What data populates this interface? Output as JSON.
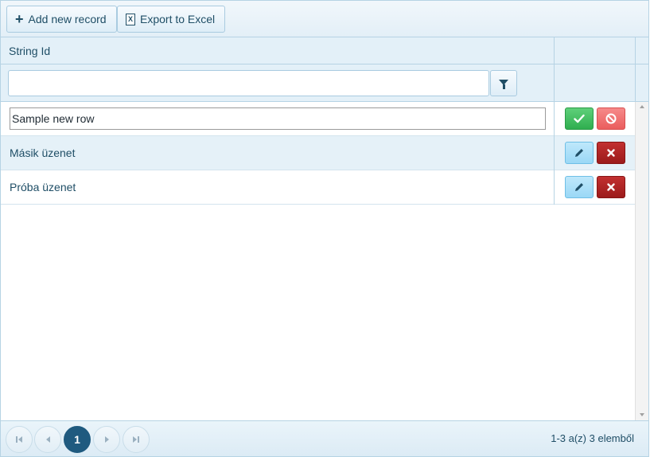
{
  "toolbar": {
    "add_label": "Add new record",
    "export_label": "Export to Excel",
    "excel_icon_letter": "X"
  },
  "header": {
    "column_title": "String Id"
  },
  "filter": {
    "value": "",
    "placeholder": ""
  },
  "rows": [
    {
      "mode": "edit",
      "value": "Sample new row"
    },
    {
      "mode": "view",
      "text": "Másik üzenet"
    },
    {
      "mode": "view",
      "text": "Próba üzenet"
    }
  ],
  "pager": {
    "current_page": "1",
    "info": "1-3 a(z) 3 elemből"
  },
  "colors": {
    "accent": "#1f5a7f",
    "text": "#1f4e66",
    "save": "#3cbf5e",
    "cancel": "#ee6b6b",
    "edit": "#a7dff8",
    "delete": "#a82222"
  },
  "icons": [
    "plus-icon",
    "excel-icon",
    "filter-icon",
    "check-icon",
    "cancel-circle-icon",
    "pencil-icon",
    "x-icon",
    "first-page-icon",
    "prev-page-icon",
    "next-page-icon",
    "last-page-icon"
  ]
}
